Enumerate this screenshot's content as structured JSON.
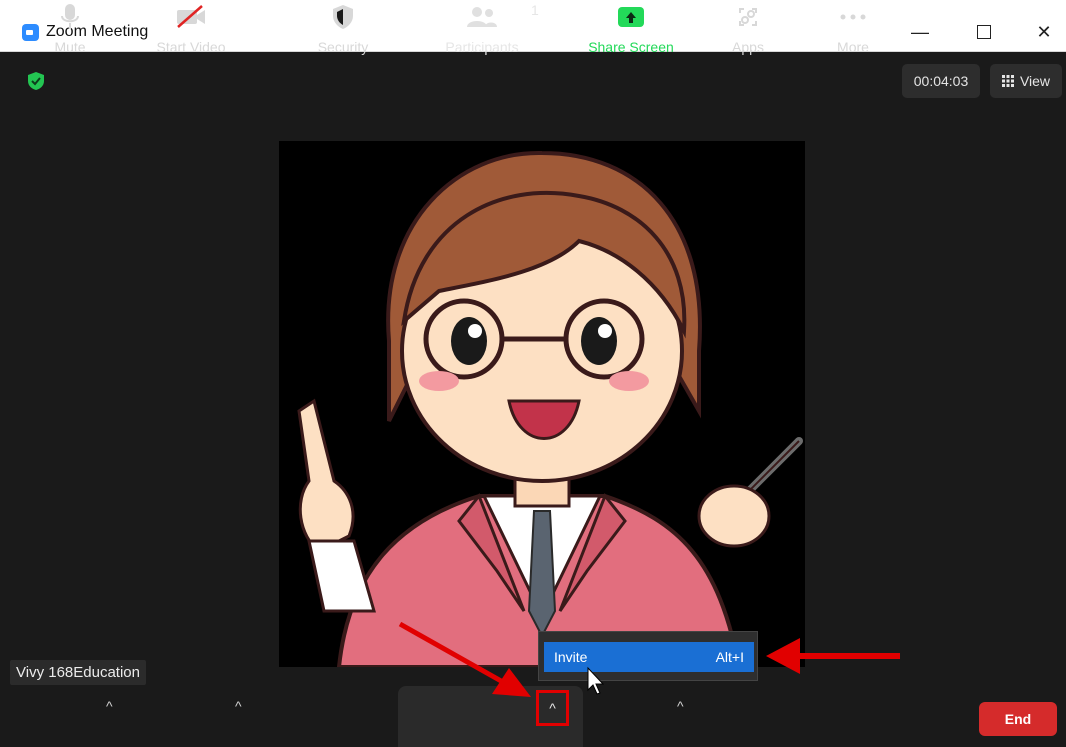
{
  "window": {
    "title": "Zoom Meeting"
  },
  "header": {
    "timer": "00:04:03",
    "view_label": "View"
  },
  "participant": {
    "name": "Vivy 168Education"
  },
  "toolbar": {
    "mute_label": "Mute",
    "start_video_label": "Start Video",
    "security_label": "Security",
    "participants_label": "Participants",
    "participants_count": "1",
    "share_screen_label": "Share Screen",
    "apps_label": "Apps",
    "more_label": "More",
    "end_label": "End"
  },
  "invite_menu": {
    "item_label": "Invite",
    "shortcut": "Alt+I"
  },
  "colors": {
    "accent": "#2d8cff",
    "share": "#23d959",
    "end": "#d52b2b",
    "highlight": "#e10000",
    "menu_selected": "#1a6fd4"
  }
}
